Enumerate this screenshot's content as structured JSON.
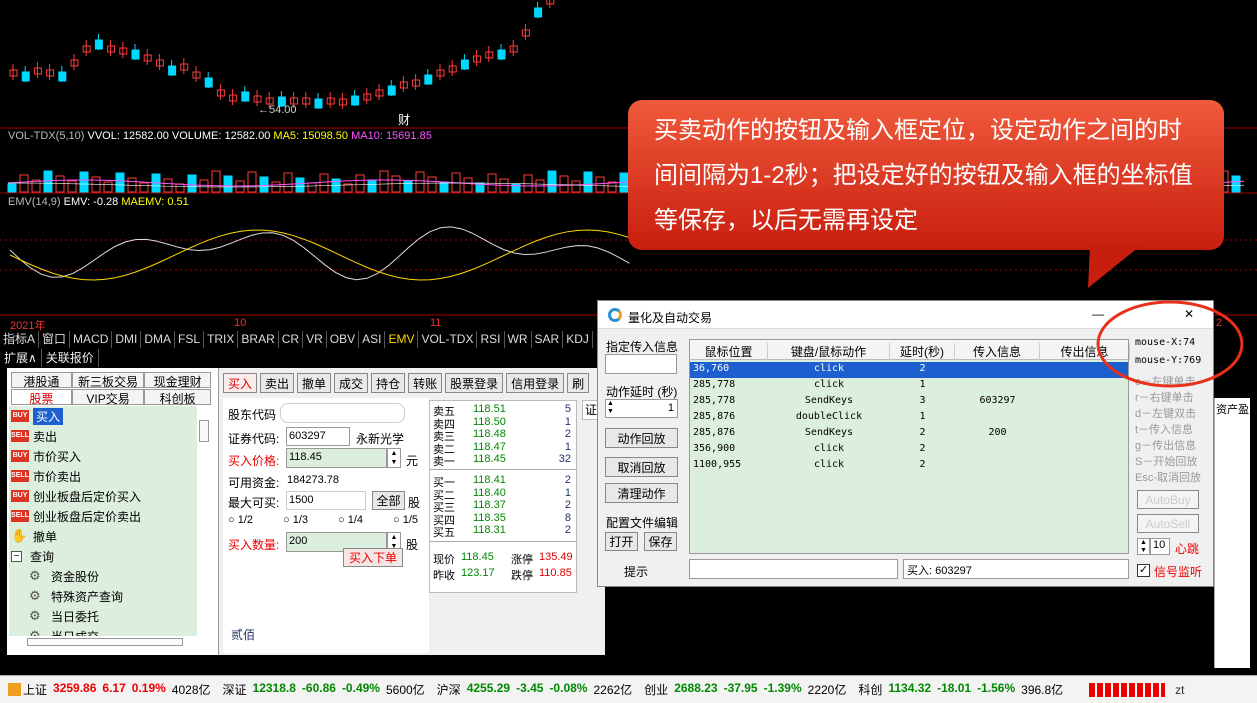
{
  "chart": {
    "low_marker": "←54.00",
    "cai_marker": "财",
    "vol_indicator": {
      "name": "VOL-TDX(5,10)",
      "vvol": "VVOL: 12582.00",
      "volume": "VOLUME: 12582.00",
      "ma5": "MA5: 15098.50",
      "ma10": "MA10: 15691.85"
    },
    "emv_indicator": {
      "name": "EMV(14,9)",
      "emv": "EMV: -0.28",
      "maemv": "MAEMV: 0.51"
    },
    "dates": [
      "2021年",
      "10",
      "11"
    ],
    "dlg_year_label": "2",
    "colors": {
      "up": "#ff3c3c",
      "down": "#00d8ff",
      "vol_label": "#ffffff",
      "ma5": "#ffff00",
      "ma10": "#ff55ff"
    }
  },
  "indicator_tabs": [
    "指标A",
    "窗口",
    "MACD",
    "DMI",
    "DMA",
    "FSL",
    "TRIX",
    "BRAR",
    "CR",
    "VR",
    "OBV",
    "ASI",
    "EMV",
    "VOL-TDX",
    "RSI",
    "WR",
    "SAR",
    "KDJ"
  ],
  "indicator_tabs_selected": "EMV",
  "sub_tabs": [
    "扩展∧",
    "关联报价"
  ],
  "trade": {
    "top_tabs": [
      "港股通",
      "新三板交易",
      "现金理财"
    ],
    "second_tabs": [
      "股票",
      "VIP交易",
      "科创板"
    ],
    "tree": [
      {
        "icon": "BUY",
        "label": "买入",
        "selected": true
      },
      {
        "icon": "SELL",
        "label": "卖出"
      },
      {
        "icon": "BUY",
        "label": "市价买入"
      },
      {
        "icon": "SELL",
        "label": "市价卖出"
      },
      {
        "icon": "BUY",
        "label": "创业板盘后定价买入"
      },
      {
        "icon": "SELL",
        "label": "创业板盘后定价卖出"
      },
      {
        "icon": "hand",
        "label": "撤单"
      },
      {
        "icon": "minus",
        "label": "查询"
      },
      {
        "icon": "gear",
        "label": "资金股份",
        "indent": true
      },
      {
        "icon": "gear",
        "label": "特殊资产查询",
        "indent": true
      },
      {
        "icon": "gear",
        "label": "当日委托",
        "indent": true
      },
      {
        "icon": "gear",
        "label": "当日成交",
        "indent": true
      }
    ],
    "toolbar": [
      "买入",
      "卖出",
      "撤单",
      "成交",
      "持仓",
      "转账",
      "股票登录",
      "信用登录",
      "刷"
    ],
    "form": {
      "code_label": "股东代码",
      "stock_code_label": "证券代码:",
      "stock_code": "603297",
      "stock_name": "永新光学",
      "price_label": "买入价格:",
      "price": "118.45",
      "price_unit": "元",
      "funds_label": "可用资金:",
      "funds": "184273.78",
      "max_label": "最大可买:",
      "max": "1500",
      "all_btn": "全部",
      "share_unit": "股",
      "fractions": [
        "1/2",
        "1/3",
        "1/4",
        "1/5"
      ],
      "qty_label": "买入数量:",
      "qty": "200",
      "qty_unit": "股",
      "submit": "买入下单",
      "footer": "贰佰"
    },
    "orderbook": {
      "sells": [
        [
          "卖五",
          "118.51",
          "5"
        ],
        [
          "卖四",
          "118.50",
          "1"
        ],
        [
          "卖三",
          "118.48",
          "2"
        ],
        [
          "卖二",
          "118.47",
          "1"
        ],
        [
          "卖一",
          "118.45",
          "32"
        ]
      ],
      "buys": [
        [
          "买一",
          "118.41",
          "2"
        ],
        [
          "买二",
          "118.40",
          "1"
        ],
        [
          "买三",
          "118.37",
          "2"
        ],
        [
          "买四",
          "118.35",
          "8"
        ],
        [
          "买五",
          "118.31",
          "2"
        ]
      ],
      "now_label": "现价",
      "now": "118.45",
      "zt_label": "涨停",
      "zt": "135.49",
      "prev_label": "昨收",
      "prev": "123.17",
      "dt_label": "跌停",
      "dt": "110.85"
    },
    "right_header": "证",
    "right_header2": "资产盈"
  },
  "dialog": {
    "title": "量化及自动交易",
    "ctrl_min": "—",
    "ctrl_close": "✕",
    "in_info_label": "指定传入信息",
    "delay_label": "动作延时 (秒)",
    "delay_value": "1",
    "buttons": [
      "动作回放",
      "取消回放",
      "清理动作"
    ],
    "config_label": "配置文件编辑",
    "open_btn": "打开",
    "save_btn": "保存",
    "hint_label": "提示",
    "status_value": "买入: 603297",
    "columns": [
      "鼠标位置",
      "键盘/鼠标动作",
      "延时(秒)",
      "传入信息",
      "传出信息"
    ],
    "rows": [
      [
        "36,760",
        "click",
        "2",
        "",
        ""
      ],
      [
        "285,778",
        "click",
        "1",
        "",
        ""
      ],
      [
        "285,778",
        "SendKeys",
        "3",
        "603297",
        ""
      ],
      [
        "285,876",
        "doubleClick",
        "1",
        "",
        ""
      ],
      [
        "285,876",
        "SendKeys",
        "2",
        "200",
        ""
      ],
      [
        "356,900",
        "click",
        "2",
        "",
        ""
      ],
      [
        "1100,955",
        "click",
        "2",
        "",
        ""
      ]
    ],
    "mouse_x": "mouse-X:74",
    "mouse_y": "mouse-Y:769",
    "shortcuts": [
      "c－左键单击",
      "r－右键单击",
      "d－左键双击",
      "t－传入信息",
      "g－传出信息",
      "S－开始回放",
      "Esc-取消回放"
    ],
    "autobuy": "AutoBuy",
    "autosell": "AutoSell",
    "jump_value": "10",
    "jump_label": "心跳",
    "signal_label": "信号监听"
  },
  "callout": "买卖动作的按钮及输入框定位，设定动作之间的时间间隔为1-2秒；把设定好的按钮及输入框的坐标值等保存，以后无需再设定",
  "status_bar": [
    {
      "name": "上证",
      "value": "3259.86",
      "chg": "6.17",
      "pct": "0.19%",
      "amt": "4028亿",
      "dir": "up"
    },
    {
      "name": "深证",
      "value": "12318.8",
      "chg": "-60.86",
      "pct": "-0.49%",
      "amt": "5600亿",
      "dir": "down"
    },
    {
      "name": "沪深",
      "value": "4255.29",
      "chg": "-3.45",
      "pct": "-0.08%",
      "amt": "2262亿",
      "dir": "down"
    },
    {
      "name": "创业",
      "value": "2688.23",
      "chg": "-37.95",
      "pct": "-1.39%",
      "amt": "2220亿",
      "dir": "down"
    },
    {
      "name": "科创",
      "value": "1134.32",
      "chg": "-18.01",
      "pct": "-1.56%",
      "amt": "396.8亿",
      "dir": "down"
    }
  ],
  "status_tail": "zt"
}
